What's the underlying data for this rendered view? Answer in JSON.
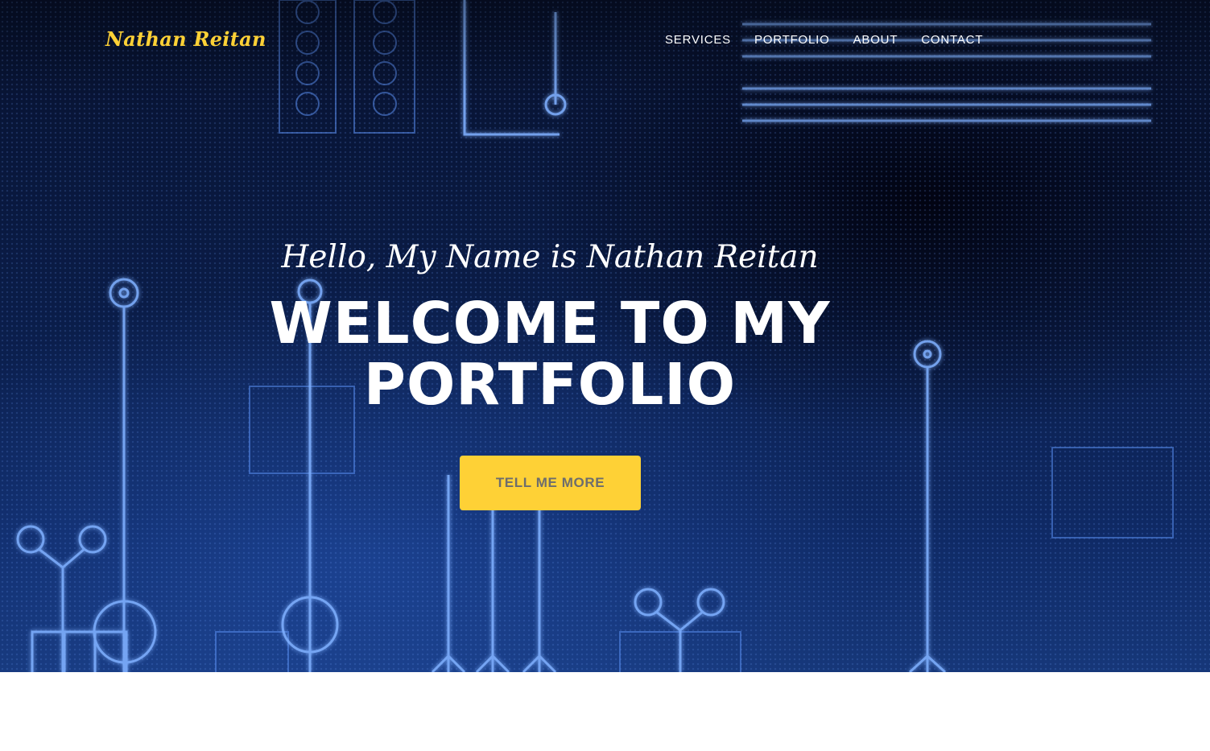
{
  "brand": {
    "name": "Nathan Reitan",
    "color": "#fed136"
  },
  "nav": {
    "items": [
      {
        "label": "SERVICES"
      },
      {
        "label": "PORTFOLIO"
      },
      {
        "label": "ABOUT"
      },
      {
        "label": "CONTACT"
      }
    ]
  },
  "hero": {
    "intro": "Hello, My Name is Nathan Reitan",
    "headline": "WELCOME TO MY PORTFOLIO",
    "cta_label": "TELL ME MORE",
    "background": "circuit-board-pattern",
    "accent_color": "#fed136",
    "primary_color": "#0a1c47"
  }
}
